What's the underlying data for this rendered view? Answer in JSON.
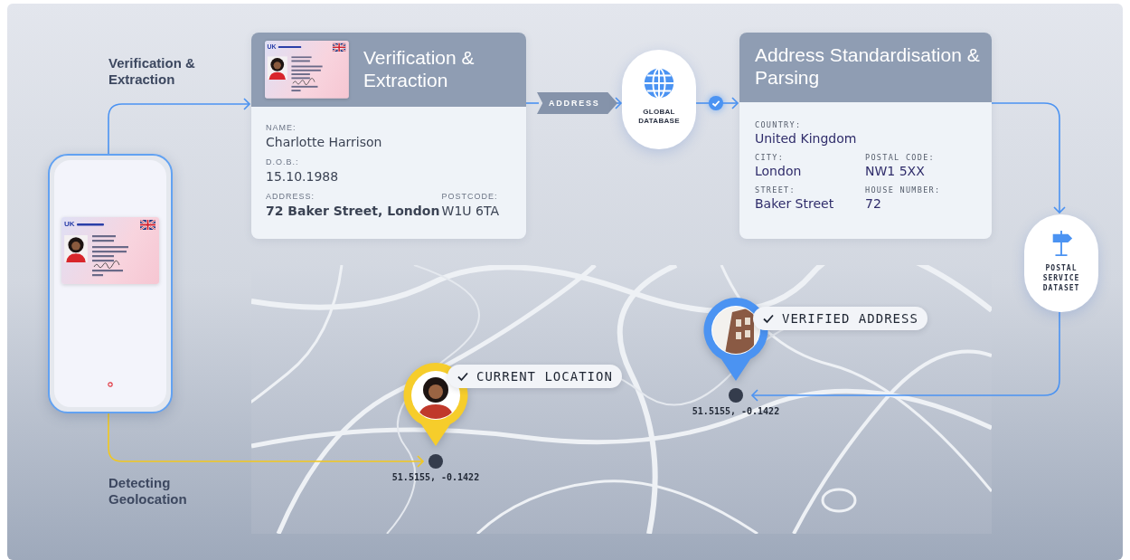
{
  "side_labels": [
    {
      "text": "Verification & Extraction"
    },
    {
      "text": "Detecting Geolocation"
    }
  ],
  "phone": {
    "licence": {
      "country": "UK"
    }
  },
  "extraction_card": {
    "title": "Verification & Extraction",
    "licence": {
      "country": "UK"
    },
    "fields": [
      {
        "label": "NAME:",
        "value": "Charlotte Harrison",
        "emphasis": false
      },
      {
        "label": "D.O.B.:",
        "value": "15.10.1988",
        "emphasis": false
      },
      {
        "label": "ADDRESS:",
        "value": "72 Baker Street, London",
        "emphasis": true
      },
      {
        "label": "POSTCODE:",
        "value": "W1U 6TA",
        "emphasis": false
      }
    ]
  },
  "address_tag": "ADDRESS",
  "database": {
    "label": "GLOBAL DATABASE"
  },
  "parsing_card": {
    "title": "Address Standardisation & Parsing",
    "fields": [
      {
        "label": "COUNTRY:",
        "value": "United Kingdom"
      },
      {
        "label": "CITY:",
        "value": "London"
      },
      {
        "label": "POSTAL CODE:",
        "value": "NW1 5XX"
      },
      {
        "label": "STREET:",
        "value": "Baker Street"
      },
      {
        "label": "HOUSE NUMBER:",
        "value": "72"
      }
    ]
  },
  "postal": {
    "label": "POSTAL SERVICE DATASET"
  },
  "map": {
    "kind": "picture",
    "pins": [
      {
        "kind": "person",
        "label": "CURRENT LOCATION",
        "coords": "51.5155, -0.1422",
        "color": "#f6cd2b"
      },
      {
        "kind": "building",
        "label": "VERIFIED ADDRESS",
        "coords": "51.5155, -0.1422",
        "color": "#4b93f2"
      }
    ]
  }
}
